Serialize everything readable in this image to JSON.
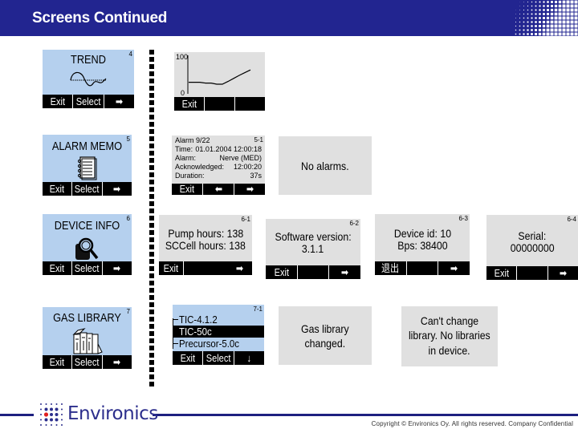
{
  "header": {
    "title": "Screens Continued",
    "bg_color": "#222590"
  },
  "screens": {
    "trend": {
      "number": "4",
      "title": "TREND",
      "icon": "trend-wave-icon",
      "keys": [
        "Exit",
        "Select",
        "➡"
      ]
    },
    "trend_graph": {
      "y_max_label": "100",
      "y_min_label": "0",
      "keys": [
        "Exit",
        "",
        ""
      ],
      "chart_data": {
        "type": "line",
        "ylim": [
          0,
          100
        ],
        "values": [
          30,
          30,
          30,
          28,
          28,
          25,
          25,
          32,
          40,
          48,
          55,
          62
        ]
      }
    },
    "alarm_memo": {
      "number": "5",
      "title": "ALARM MEMO",
      "icon": "notebook-icon",
      "keys": [
        "Exit",
        "Select",
        "➡"
      ]
    },
    "alarm_detail": {
      "number": "5-1",
      "rows": [
        {
          "label": "Alarm 9/22",
          "value": ""
        },
        {
          "label": "Time:",
          "value": "01.01.2004 12:00:18"
        },
        {
          "label": "Alarm:",
          "value": "Nerve (MED)"
        },
        {
          "label": "Acknowledged:",
          "value": "12:00:20"
        },
        {
          "label": "Duration:",
          "value": "37s"
        }
      ],
      "keys": [
        "Exit",
        "⬅",
        "➡"
      ]
    },
    "no_alarms": {
      "message": "No alarms."
    },
    "device_info": {
      "number": "6",
      "title": "DEVICE INFO",
      "icon": "magnifier-device-icon",
      "keys": [
        "Exit",
        "Select",
        "➡"
      ]
    },
    "pump_hours": {
      "number": "6-1",
      "line1": "Pump hours: 138",
      "line2": "SCCell hours: 138",
      "keys": [
        "Exit",
        "",
        "➡"
      ]
    },
    "software_version": {
      "number": "6-2",
      "line1": "Software version:",
      "line2": "3.1.1",
      "keys": [
        "Exit",
        "",
        "➡"
      ]
    },
    "device_id": {
      "number": "6-3",
      "line1": "Device id: 10",
      "line2": "Bps: 38400",
      "keys": [
        "退出",
        "",
        "➡"
      ]
    },
    "serial": {
      "number": "6-4",
      "line1": "Serial:",
      "line2": "00000000",
      "keys": [
        "Exit",
        "",
        "➡"
      ]
    },
    "gas_library": {
      "number": "7",
      "title": "GAS LIBRARY",
      "icon": "books-icon",
      "keys": [
        "Exit",
        "Select",
        "➡"
      ]
    },
    "library_list": {
      "number": "7-1",
      "items": [
        "TIC-4.1.2",
        "TIC-50c",
        "Precursor-5.0c"
      ],
      "selected_index": 1,
      "keys": [
        "Exit",
        "Select",
        "↓"
      ]
    },
    "library_changed": {
      "line1": "Gas library",
      "line2": "changed."
    },
    "cant_change": {
      "line1": "Can't change",
      "line2": "library. No libraries",
      "line3": "in device."
    }
  },
  "footer": {
    "logo_text": "Environics",
    "copyright": "Copyright © Environics Oy. All rights reserved. Company Confidential",
    "line_color": "#1d2080"
  }
}
